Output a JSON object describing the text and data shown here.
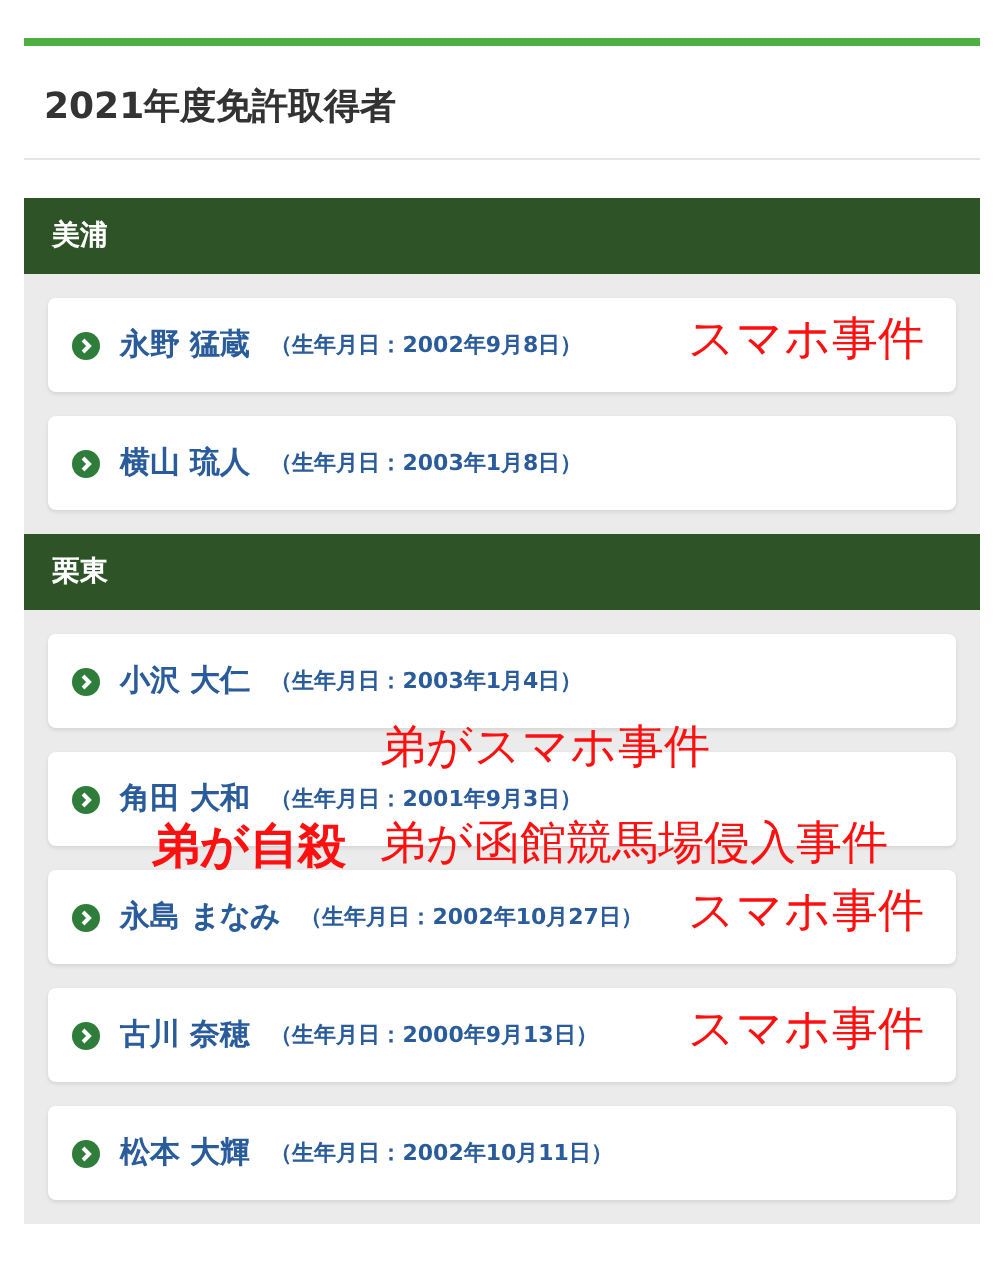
{
  "title": "2021年度免許取得者",
  "sections": [
    {
      "name": "美浦",
      "people": [
        {
          "name": "永野 猛蔵",
          "birth": "（生年月日：2002年9月8日）",
          "notes": [
            {
              "text": "スマホ事件",
              "kind": "serif"
            }
          ]
        },
        {
          "name": "横山 琉人",
          "birth": "（生年月日：2003年1月8日）"
        }
      ]
    },
    {
      "name": "栗東",
      "people": [
        {
          "name": "小沢 大仁",
          "birth": "（生年月日：2003年1月4日）"
        },
        {
          "name": "角田 大和",
          "birth": "（生年月日：2001年9月3日）",
          "notes": [
            {
              "text": "弟がスマホ事件",
              "kind": "serif"
            },
            {
              "text": "弟が自殺",
              "kind": "bold"
            },
            {
              "text": "弟が函館競馬場侵入事件",
              "kind": "serif"
            }
          ]
        },
        {
          "name": "永島 まなみ",
          "birth": "（生年月日：2002年10月27日）",
          "notes": [
            {
              "text": "スマホ事件",
              "kind": "serif"
            }
          ]
        },
        {
          "name": "古川 奈穂",
          "birth": "（生年月日：2000年9月13日）",
          "notes": [
            {
              "text": "スマホ事件",
              "kind": "serif"
            }
          ]
        },
        {
          "name": "松本 大輝",
          "birth": "（生年月日：2002年10月11日）"
        }
      ]
    }
  ]
}
